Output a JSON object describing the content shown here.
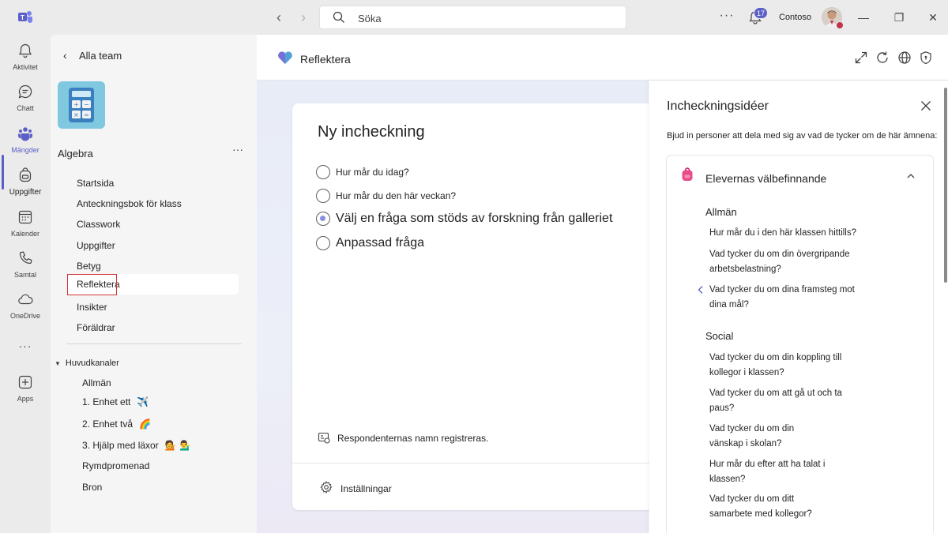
{
  "titlebar": {
    "search_placeholder": "Söka",
    "notifications_count": "17",
    "org_name": "Contoso",
    "more_label": "···"
  },
  "rail": {
    "items": [
      {
        "label": "Aktivitet",
        "icon": "bell-icon"
      },
      {
        "label": "Chatt",
        "icon": "chat-icon"
      },
      {
        "label": "Mängder",
        "icon": "teams-icon"
      },
      {
        "label": "Uppgifter",
        "icon": "backpack-icon"
      },
      {
        "label": "Kalender",
        "icon": "calendar-icon"
      },
      {
        "label": "Samtal",
        "icon": "phone-icon"
      },
      {
        "label": "OneDrive",
        "icon": "cloud-icon"
      },
      {
        "label": "Apps",
        "icon": "add-app-icon"
      }
    ],
    "active_index": 2,
    "more_label": "···"
  },
  "team_pane": {
    "back_label": "Alla team",
    "team_name": "Algebra",
    "tabs": [
      "Startsida",
      "Anteckningsbok för klass",
      "Classwork",
      "Uppgifter",
      "Betyg",
      "Reflektera",
      "Insikter",
      "Föräldrar"
    ],
    "selected_tab": "Reflektera",
    "channels_header": "Huvudkanaler",
    "channels": [
      {
        "label": "Allmän",
        "emoji": ""
      },
      {
        "label": "1. Enhet ett",
        "emoji": "✈️"
      },
      {
        "label": "2. Enhet två",
        "emoji": "🌈"
      },
      {
        "label": "3. Hjälp med läxor",
        "emoji": "💁 💁‍♂️"
      },
      {
        "label": "Rymdpromenad",
        "emoji": ""
      },
      {
        "label": "Bron",
        "emoji": ""
      }
    ]
  },
  "app": {
    "title": "Reflektera",
    "accent": "#5b5fc7"
  },
  "checkin": {
    "title": "Ny incheckning",
    "options": [
      {
        "label": "Hur mår du idag?",
        "checked": false
      },
      {
        "label": "Hur mår du den här veckan?",
        "checked": false
      },
      {
        "label": "Välj en fråga som stöds av forskning från galleriet",
        "checked": true
      },
      {
        "label": "Anpassad fråga",
        "checked": false
      }
    ],
    "respondents_note": "Respondenternas namn registreras.",
    "settings_label": "Inställningar"
  },
  "ideas": {
    "title": "Incheckningsidéer",
    "subtitle": "Bjud in personer att dela med sig av vad de tycker om de här ämnena:",
    "category": "Elevernas välbefinnande",
    "sections": [
      {
        "heading": "Allmän",
        "questions": [
          "Hur mår du i den här klassen hittills?",
          "Vad tycker du om din övergripande arbetsbelastning?",
          "Vad tycker du om dina framsteg mot dina mål?"
        ]
      },
      {
        "heading": "Social",
        "questions": [
          "Vad tycker du om din koppling till kollegor i klassen?",
          "Vad tycker du om att gå ut och ta paus?",
          "Vad tycker du om din vänskap i skolan?",
          "Hur mår du efter att ha talat i klassen?",
          "Vad tycker du om ditt samarbete med kollegor?"
        ]
      }
    ]
  }
}
